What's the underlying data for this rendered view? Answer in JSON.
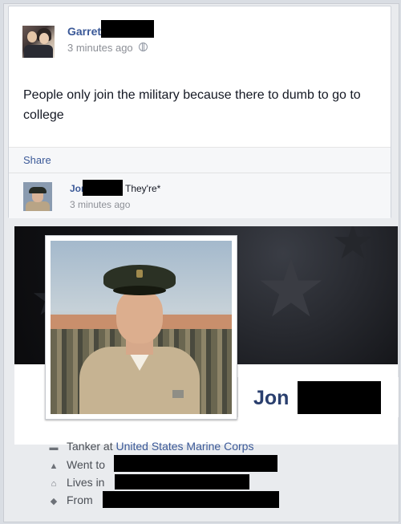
{
  "post": {
    "author": "Garret",
    "time": "3 minutes ago",
    "body": "People only join the military because there to dumb to go to college",
    "share_label": "Share"
  },
  "comment": {
    "author": "Jon",
    "text": "They're*",
    "time": "3 minutes ago"
  },
  "profile": {
    "name": "Jon",
    "info": [
      {
        "icon": "briefcase-icon",
        "prefix": "Tanker at",
        "link": "United States Marine Corps"
      },
      {
        "icon": "graduation-cap-icon",
        "prefix": "Went to",
        "link": ""
      },
      {
        "icon": "house-icon",
        "prefix": "Lives in",
        "link": ""
      },
      {
        "icon": "location-icon",
        "prefix": "From",
        "link": ""
      }
    ]
  },
  "colors": {
    "link": "#3b5998",
    "text": "#141823",
    "meta": "#8c8f96",
    "cover": "#15161a"
  }
}
